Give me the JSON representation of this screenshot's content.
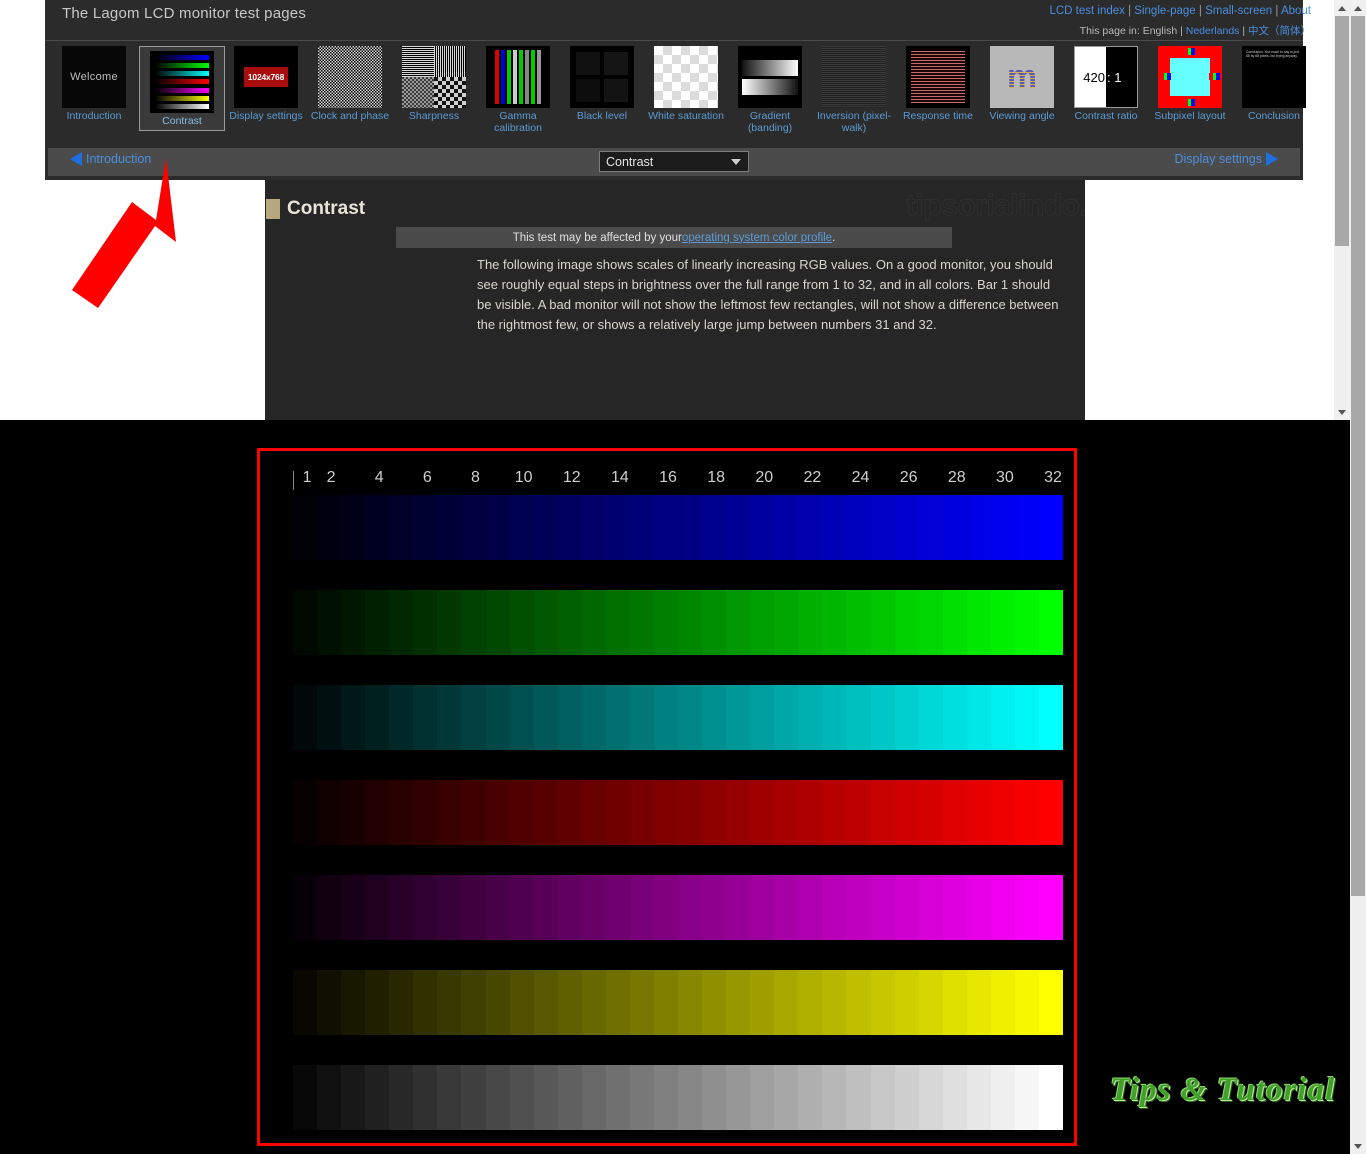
{
  "site": {
    "title": "The Lagom LCD monitor test pages",
    "top_links": [
      "LCD test index",
      "Single-page",
      "Small-screen",
      "About"
    ],
    "language_prefix": "This page in:",
    "languages": [
      "English",
      "Nederlands",
      "中文（简体）"
    ]
  },
  "thumbnails": [
    {
      "label": "Introduction",
      "art": "welcome",
      "text": "Welcome",
      "active": false
    },
    {
      "label": "Contrast",
      "art": "contrast",
      "active": true
    },
    {
      "label": "Display settings",
      "art": "display",
      "text": "1024x768",
      "active": false
    },
    {
      "label": "Clock and phase",
      "art": "checker",
      "active": false
    },
    {
      "label": "Sharpness",
      "art": "sharp",
      "active": false
    },
    {
      "label": "Gamma calibration",
      "art": "gamma",
      "active": false
    },
    {
      "label": "Black level",
      "art": "black",
      "active": false
    },
    {
      "label": "White saturation",
      "art": "white",
      "active": false
    },
    {
      "label": "Gradient (banding)",
      "art": "grad",
      "active": false
    },
    {
      "label": "Inversion (pixel-walk)",
      "art": "inv",
      "active": false
    },
    {
      "label": "Response time",
      "art": "resp",
      "active": false
    },
    {
      "label": "Viewing angle",
      "art": "view",
      "text": "m",
      "active": false
    },
    {
      "label": "Contrast ratio",
      "art": "cratio",
      "text_left": "420",
      "text_right": ": 1",
      "active": false
    },
    {
      "label": "Subpixel layout",
      "art": "subpixel",
      "active": false
    },
    {
      "label": "Conclusion",
      "art": "conclusion",
      "text": "Conclusion. Not much to say in just 68 by 68 pixels, but trying anyway."
    }
  ],
  "navbar": {
    "prev_label": "Introduction",
    "next_label": "Display settings",
    "selected_page": "Contrast"
  },
  "content": {
    "heading": "Contrast",
    "notice_prefix": "This test may be affected by your ",
    "notice_link": "operating system color profile",
    "notice_suffix": ".",
    "paragraph": "The following image shows scales of linearly increasing RGB values. On a good monitor, you should see roughly equal steps in brightness over the full range from 1 to 32, and in all colors. Bar 1 should be visible. A bad monitor will not show the leftmost few rectangles, will not show a difference between the rightmost few, or shows a relatively large jump between numbers 31 and 32.",
    "watermark_url": "tipsorialindo.blogspot.com"
  },
  "test_pattern": {
    "steps": 32,
    "tick_labels": [
      "1",
      "2",
      "4",
      "6",
      "8",
      "10",
      "12",
      "14",
      "16",
      "18",
      "20",
      "22",
      "24",
      "26",
      "28",
      "30",
      "32"
    ],
    "tick_indices": [
      1,
      2,
      4,
      6,
      8,
      10,
      12,
      14,
      16,
      18,
      20,
      22,
      24,
      26,
      28,
      30,
      32
    ],
    "bars": [
      {
        "name": "blue",
        "channels": [
          0,
          0,
          1
        ],
        "peak": "#0000ff"
      },
      {
        "name": "green",
        "channels": [
          0,
          1,
          0
        ],
        "peak": "#00ff00"
      },
      {
        "name": "cyan",
        "channels": [
          0,
          1,
          1
        ],
        "peak": "#00ffff"
      },
      {
        "name": "red",
        "channels": [
          1,
          0,
          0
        ],
        "peak": "#ff0000"
      },
      {
        "name": "magenta",
        "channels": [
          1,
          0,
          1
        ],
        "peak": "#ff00ff"
      },
      {
        "name": "yellow",
        "channels": [
          1,
          1,
          0
        ],
        "peak": "#ffff00"
      },
      {
        "name": "white",
        "channels": [
          1,
          1,
          1
        ],
        "peak": "#ffffff"
      }
    ]
  },
  "annotations": {
    "highlight_color": "#ff0000",
    "arrow_color": "#ff0000",
    "arrow_target": "Contrast"
  },
  "branding": {
    "logo_text": "Tips & Tutorial",
    "logo_color": "#3fa02a"
  }
}
